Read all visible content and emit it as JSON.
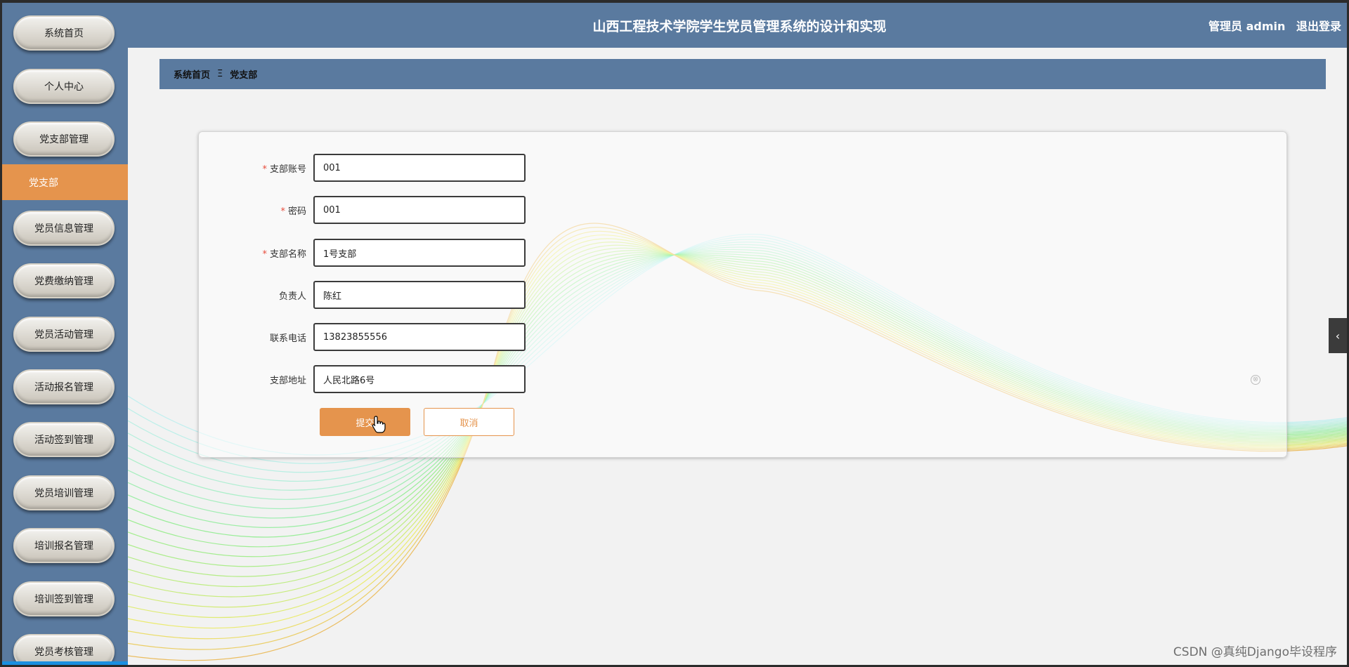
{
  "header": {
    "title": "山西工程技术学院学生党员管理系统的设计和实现",
    "user_label": "管理员 admin",
    "logout_label": "退出登录"
  },
  "sidebar": {
    "items": [
      {
        "label": "系统首页"
      },
      {
        "label": "个人中心"
      },
      {
        "label": "党支部管理"
      },
      {
        "label": "党员信息管理"
      },
      {
        "label": "党费缴纳管理"
      },
      {
        "label": "党员活动管理"
      },
      {
        "label": "活动报名管理"
      },
      {
        "label": "活动签到管理"
      },
      {
        "label": "党员培训管理"
      },
      {
        "label": "培训报名管理"
      },
      {
        "label": "培训签到管理"
      },
      {
        "label": "党员考核管理"
      }
    ],
    "active_sub": "党支部"
  },
  "breadcrumb": {
    "home": "系统首页",
    "separator": "Ξ",
    "current": "党支部"
  },
  "form": {
    "fields": [
      {
        "label": "支部账号",
        "required": "*",
        "value": "001"
      },
      {
        "label": "密码",
        "required": "*",
        "value": "001"
      },
      {
        "label": "支部名称",
        "required": "*",
        "value": "1号支部"
      },
      {
        "label": "负责人",
        "required": "",
        "value": "陈红"
      },
      {
        "label": "联系电话",
        "required": "",
        "value": "13823855556"
      },
      {
        "label": "支部地址",
        "required": "",
        "value": "人民北路6号"
      }
    ],
    "submit_label": "提交",
    "cancel_label": "取消",
    "clear_icon": "⊗"
  },
  "collapse_icon": "‹",
  "watermark": "CSDN @真纯Django毕设程序",
  "colors": {
    "primary": "#5a7a9f",
    "accent": "#e5944d"
  }
}
